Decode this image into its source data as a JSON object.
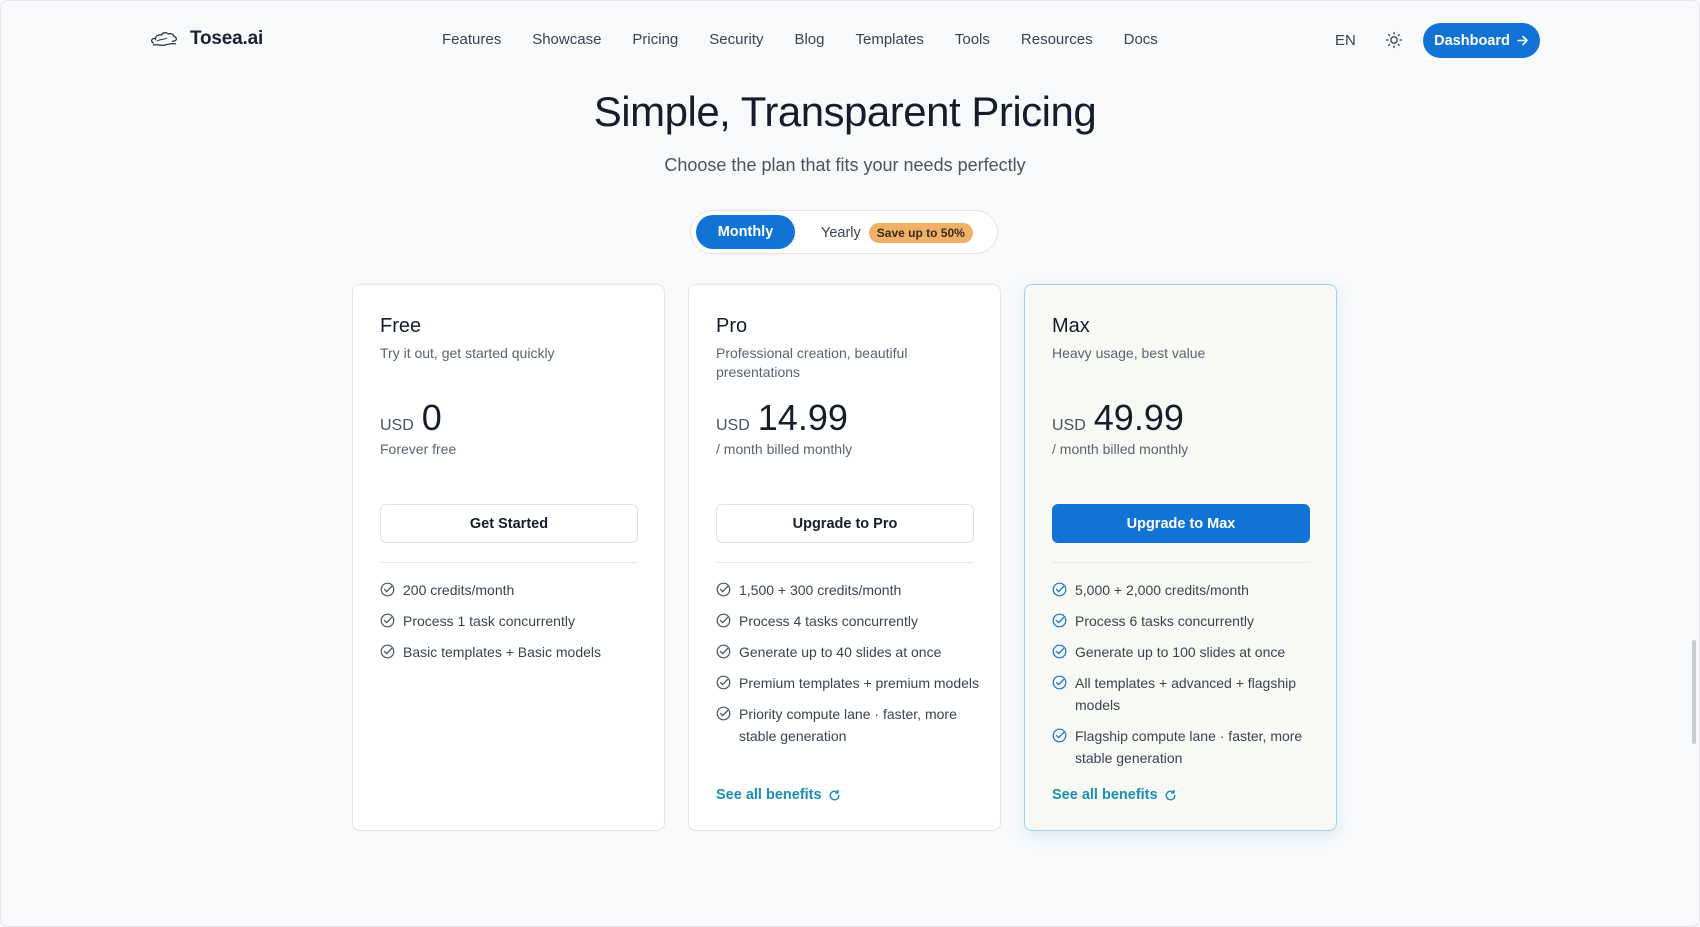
{
  "header": {
    "brand": "Tosea.ai",
    "nav": [
      "Features",
      "Showcase",
      "Pricing",
      "Security",
      "Blog",
      "Templates",
      "Tools",
      "Resources",
      "Docs"
    ],
    "lang": "EN",
    "dashboard_label": "Dashboard"
  },
  "hero": {
    "title": "Simple, Transparent Pricing",
    "subtitle": "Choose the plan that fits your needs perfectly"
  },
  "billing": {
    "monthly": "Monthly",
    "yearly": "Yearly",
    "save_badge": "Save up to 50%",
    "selected": "Monthly"
  },
  "plans": [
    {
      "name": "Free",
      "desc": "Try it out, get started quickly",
      "currency": "USD",
      "price": "0",
      "note": "Forever free",
      "cta": "Get Started",
      "features": [
        "200 credits/month",
        "Process 1 task concurrently",
        "Basic templates + Basic models"
      ],
      "see_all": ""
    },
    {
      "name": "Pro",
      "desc": "Professional creation, beautiful presentations",
      "currency": "USD",
      "price": "14.99",
      "note": "/ month billed monthly",
      "cta": "Upgrade to Pro",
      "features": [
        "1,500 + 300 credits/month",
        "Process 4 tasks concurrently",
        "Generate up to 40 slides at once",
        "Premium templates + premium models",
        "Priority compute lane · faster, more stable generation"
      ],
      "see_all": "See all benefits"
    },
    {
      "name": "Max",
      "desc": "Heavy usage, best value",
      "currency": "USD",
      "price": "49.99",
      "note": "/ month billed monthly",
      "cta": "Upgrade to Max",
      "features": [
        "5,000 + 2,000 credits/month",
        "Process 6 tasks concurrently",
        "Generate up to 100 slides at once",
        "All templates + advanced + flagship models",
        "Flagship compute lane · faster, more stable generation"
      ],
      "see_all": "See all benefits"
    }
  ],
  "colors": {
    "primary": "#1173d4",
    "accent_link": "#1a8fb3",
    "badge": "#f0b06a",
    "max_border": "#9fd4e8"
  }
}
